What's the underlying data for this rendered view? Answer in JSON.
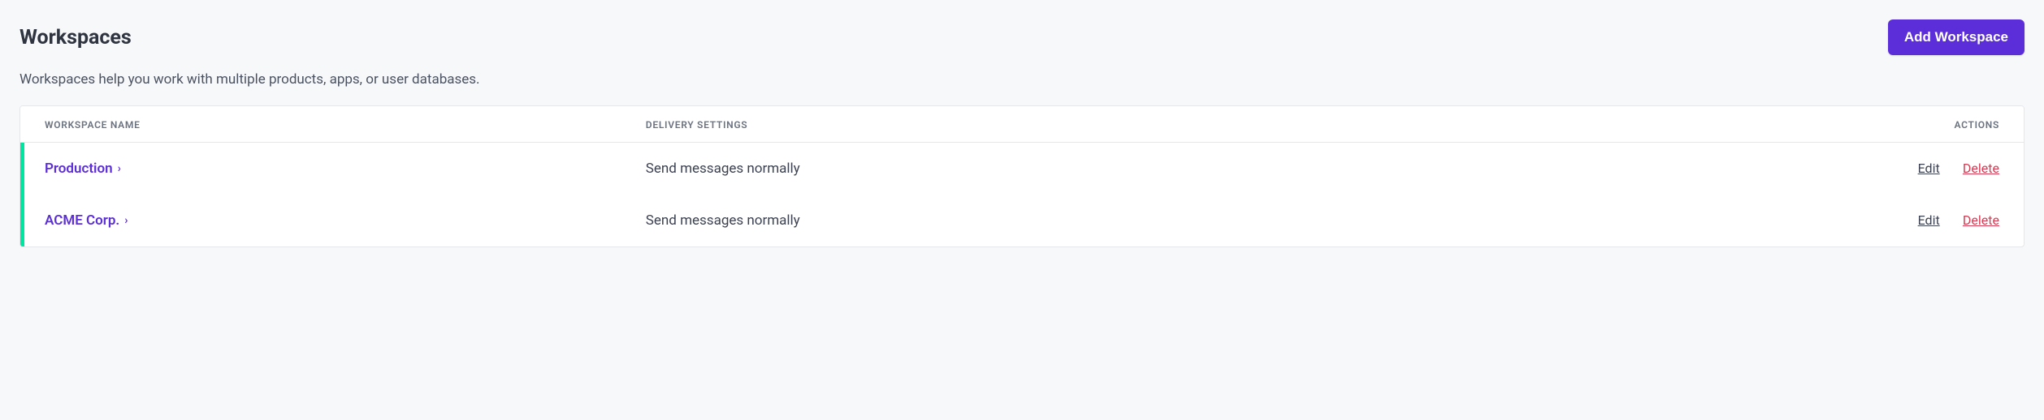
{
  "header": {
    "title": "Workspaces",
    "add_button_label": "Add Workspace"
  },
  "description": "Workspaces help you work with multiple products, apps, or user databases.",
  "table": {
    "columns": {
      "name": "WORKSPACE NAME",
      "delivery": "DELIVERY SETTINGS",
      "actions": "ACTIONS"
    },
    "rows": [
      {
        "name": "Production",
        "delivery": "Send messages normally",
        "edit_label": "Edit",
        "delete_label": "Delete",
        "has_indicator": true
      },
      {
        "name": "ACME Corp.",
        "delivery": "Send messages normally",
        "edit_label": "Edit",
        "delete_label": "Delete",
        "has_indicator": true
      }
    ]
  }
}
